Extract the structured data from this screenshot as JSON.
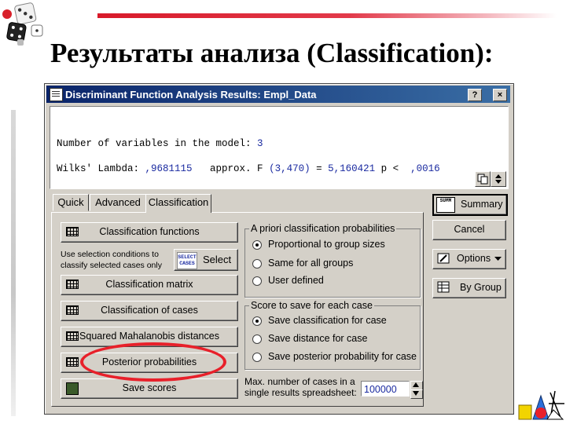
{
  "slide": {
    "title": "Результаты анализа (Classification):"
  },
  "window": {
    "title": "Discriminant Function Analysis Results: Empl_Data",
    "help_button": "?",
    "close_button": "×"
  },
  "output": {
    "line1_label": "Number of variables in the model: ",
    "line1_value": "3",
    "line2_label": "Wilks' Lambda: ",
    "line2_lambda": ",9681115",
    "line2_approx": "   approx. F ",
    "line2_df": "(3,470)",
    "line2_eq": " = ",
    "line2_f": "5,160421",
    "line2_p": " p <  ",
    "line2_pval": ",0016"
  },
  "tabs": [
    {
      "label": "Quick"
    },
    {
      "label": "Advanced"
    },
    {
      "label": "Classification",
      "active": true
    }
  ],
  "left_buttons": {
    "classification_functions": "Classification functions",
    "selection_note_line1": "Use selection conditions to",
    "selection_note_line2": "classify selected cases only",
    "select_icon_line1": "SELECT",
    "select_icon_line2": "CASES",
    "select": "Select",
    "classification_matrix": "Classification matrix",
    "classification_of_cases": "Classification of cases",
    "squared_mahalanobis": "Squared Mahalanobis distances",
    "posterior_probabilities": "Posterior probabilities",
    "save_scores": "Save scores"
  },
  "a_priori": {
    "legend": "A priori classification probabilities",
    "options": [
      "Proportional to group sizes",
      "Same for all groups",
      "User defined"
    ],
    "selected": "Proportional to group sizes"
  },
  "score_save": {
    "legend": "Score to save for each case",
    "options": [
      "Save classification for case",
      "Save distance for case",
      "Save posterior probability for case"
    ],
    "selected": "Save classification for case"
  },
  "max_cases": {
    "label_line1": "Max. number of cases in a",
    "label_line2": "single results spreadsheet:",
    "value": "100000"
  },
  "right_buttons": {
    "summary_icon": "SUMM",
    "summary": "Summary",
    "cancel": "Cancel",
    "options": "Options",
    "by_group": "By Group"
  }
}
